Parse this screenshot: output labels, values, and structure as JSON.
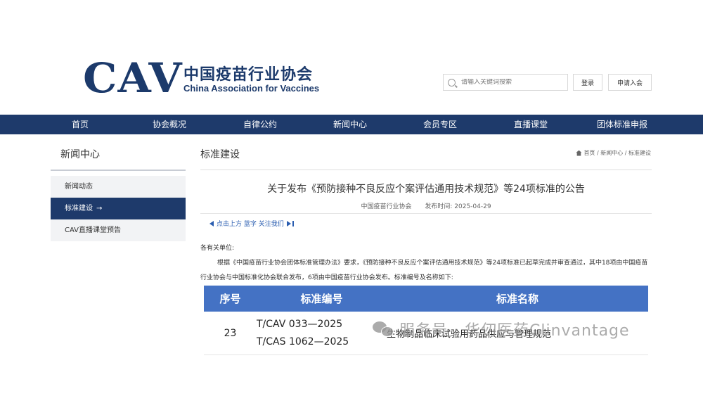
{
  "header": {
    "logo_mark": "CAV",
    "logo_cn": "中国疫苗行业协会",
    "logo_en": "China Association for Vaccines",
    "search_placeholder": "请输入关键词搜索",
    "login_label": "登录",
    "join_label": "申请入会"
  },
  "nav": {
    "items": [
      {
        "label": "首页"
      },
      {
        "label": "协会概况"
      },
      {
        "label": "自律公约"
      },
      {
        "label": "新闻中心"
      },
      {
        "label": "会员专区"
      },
      {
        "label": "直播课堂"
      },
      {
        "label": "团体标准申报"
      }
    ]
  },
  "sidebar": {
    "title": "新闻中心",
    "items": [
      {
        "label": "新闻动态"
      },
      {
        "label": "标准建设"
      },
      {
        "label": "CAV直播课堂预告"
      }
    ]
  },
  "main": {
    "title": "标准建设",
    "breadcrumb": "首页 / 新闻中心 / 标准建设",
    "article_title": "关于发布《预防接种不良反应个案评估通用技术规范》等24项标准的公告",
    "publisher": "中国疫苗行业协会",
    "publish_time": "发布时间:  2025-04-29",
    "sharebar_text": "点击上方 蓝字 关注我们",
    "greeting": "各有关单位:",
    "body": "根据《中国疫苗行业协会团体标准管理办法》要求，《预防接种不良反应个案评估通用技术规范》等24项标准已起草完成并审查通过，其中18项由中国疫苗行业协会与中国标准化协会联合发布，6项由中国疫苗行业协会发布。标准编号及名称如下:"
  },
  "table": {
    "headers": [
      "序号",
      "标准编号",
      "标准名称"
    ],
    "rows": [
      {
        "no": "23",
        "code1": "T/CAV 033—2025",
        "code2": "T/CAS 1062—2025",
        "name": "生物制品临床试验用药品供应与管理规范"
      }
    ]
  },
  "watermark": "服务号 · 华仞医药Clinvantage",
  "colors": {
    "brand": "#1e3a6b",
    "table_header": "#4472c4",
    "link": "#2a5db0"
  }
}
